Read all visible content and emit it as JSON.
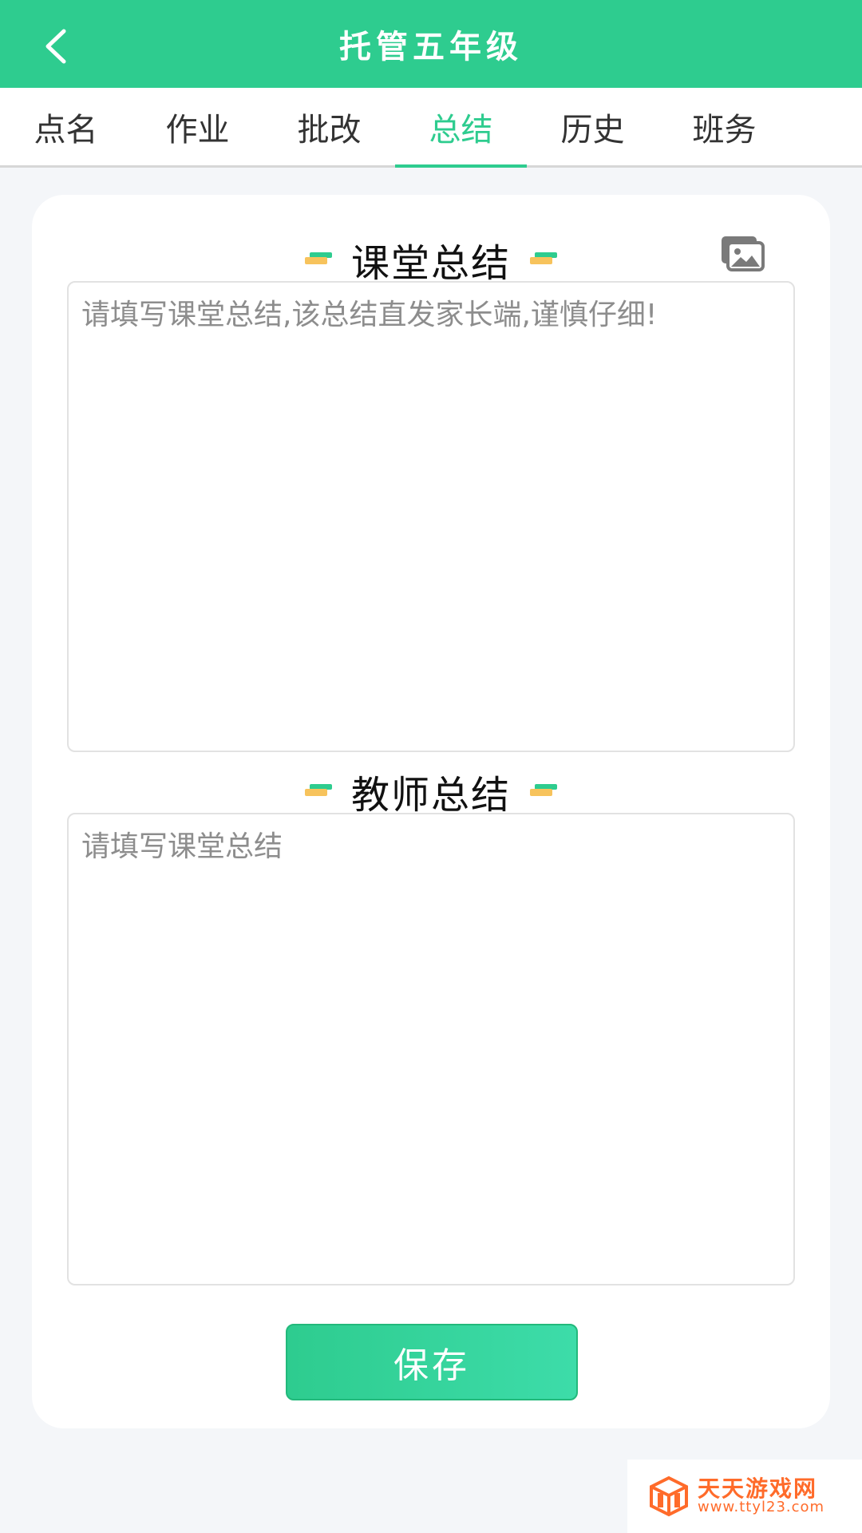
{
  "header": {
    "title": "托管五年级",
    "back_icon": "chevron-left-icon"
  },
  "tabs": [
    {
      "label": "点名",
      "active": false
    },
    {
      "label": "作业",
      "active": false
    },
    {
      "label": "批改",
      "active": false
    },
    {
      "label": "总结",
      "active": true
    },
    {
      "label": "历史",
      "active": false
    },
    {
      "label": "班务",
      "active": false
    }
  ],
  "card": {
    "class_summary": {
      "title": "课堂总结",
      "placeholder": "请填写课堂总结,该总结直发家长端,谨慎仔细!",
      "value": "",
      "image_icon": "image-gallery-icon"
    },
    "teacher_summary": {
      "title": "教师总结",
      "placeholder": "请填写课堂总结",
      "value": ""
    },
    "save_label": "保存"
  },
  "watermark": {
    "title": "天天游戏网",
    "url": "www.ttyl23.com"
  },
  "colors": {
    "primary": "#2ecc8f",
    "accent_yellow": "#f7c35c",
    "background": "#f4f6f9",
    "watermark": "#ff6b2a"
  }
}
